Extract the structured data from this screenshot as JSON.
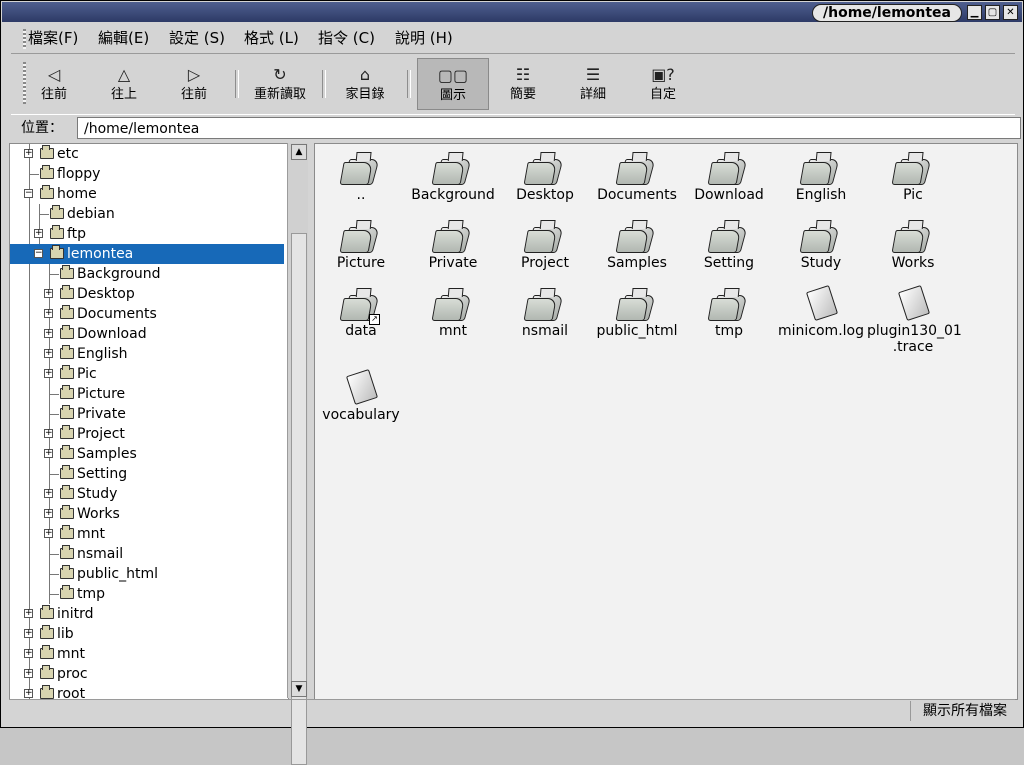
{
  "window": {
    "title": "/home/lemontea",
    "buttons": [
      "▁",
      "▢",
      "✕"
    ]
  },
  "menubar": {
    "items": [
      "檔案(F)",
      "編輯(E)",
      "設定 (S)",
      "格式 (L)",
      "指令 (C)",
      "說明 (H)"
    ]
  },
  "toolbar": {
    "items": [
      {
        "label": "往前",
        "icon": "back-arrow-icon",
        "glyph": "◁"
      },
      {
        "label": "往上",
        "icon": "up-arrow-icon",
        "glyph": "△"
      },
      {
        "label": "往前",
        "icon": "forward-arrow-icon",
        "glyph": "▷"
      },
      {
        "label": "重新讀取",
        "icon": "refresh-icon",
        "glyph": "↻"
      },
      {
        "label": "家目錄",
        "icon": "home-icon",
        "glyph": "⌂"
      },
      {
        "label": "圖示",
        "icon": "icon-view-icon",
        "glyph": "▢▢",
        "active": true
      },
      {
        "label": "簡要",
        "icon": "brief-view-icon",
        "glyph": "☷"
      },
      {
        "label": "詳細",
        "icon": "detail-view-icon",
        "glyph": "☰"
      },
      {
        "label": "自定",
        "icon": "custom-view-icon",
        "glyph": "▣?"
      }
    ]
  },
  "location": {
    "label": "位置：",
    "value": "/home/lemontea"
  },
  "tree": {
    "rows": [
      "etc",
      "floppy",
      "home",
      "debian",
      "ftp",
      "lemontea",
      "Background",
      "Desktop",
      "Documents",
      "Download",
      "English",
      "Pic",
      "Picture",
      "Private",
      "Project",
      "Samples",
      "Setting",
      "Study",
      "Works",
      "mnt",
      "nsmail",
      "public_html",
      "tmp",
      "initrd",
      "lib",
      "mnt",
      "proc",
      "root"
    ],
    "selected": "lemontea"
  },
  "files": {
    "items": [
      {
        "label": "..",
        "type": "folder"
      },
      {
        "label": "Background",
        "type": "folder"
      },
      {
        "label": "Desktop",
        "type": "folder"
      },
      {
        "label": "Documents",
        "type": "folder"
      },
      {
        "label": "Download",
        "type": "folder"
      },
      {
        "label": "English",
        "type": "folder"
      },
      {
        "label": "Pic",
        "type": "folder"
      },
      {
        "label": "Picture",
        "type": "folder"
      },
      {
        "label": "Private",
        "type": "folder"
      },
      {
        "label": "Project",
        "type": "folder"
      },
      {
        "label": "Samples",
        "type": "folder"
      },
      {
        "label": "Setting",
        "type": "folder"
      },
      {
        "label": "Study",
        "type": "folder"
      },
      {
        "label": "Works",
        "type": "folder"
      },
      {
        "label": "data",
        "type": "folder-link"
      },
      {
        "label": "mnt",
        "type": "folder"
      },
      {
        "label": "nsmail",
        "type": "folder"
      },
      {
        "label": "public_html",
        "type": "folder"
      },
      {
        "label": "tmp",
        "type": "folder"
      },
      {
        "label": "minicom.log",
        "type": "file"
      },
      {
        "label": "plugin130_01\n.trace",
        "type": "file"
      },
      {
        "label": "vocabulary",
        "type": "file"
      }
    ]
  },
  "status": {
    "right": "顯示所有檔案"
  }
}
